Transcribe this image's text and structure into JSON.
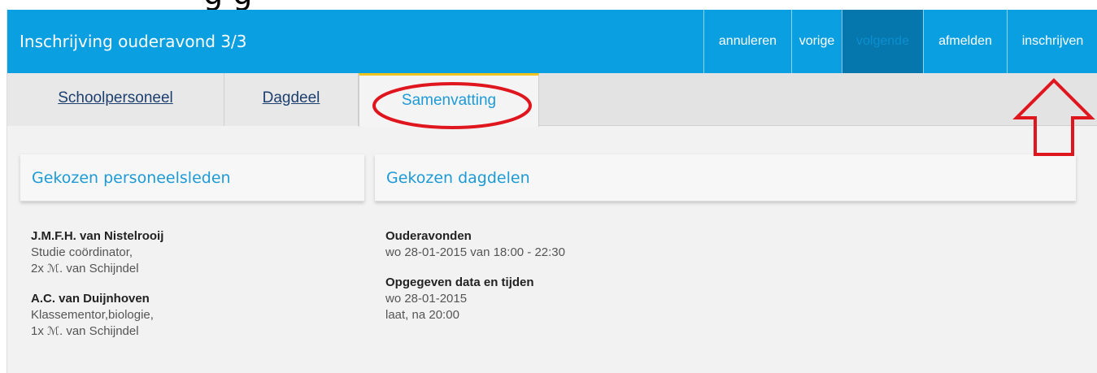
{
  "app": {
    "title": "Inschrijving ouderavond 3/3"
  },
  "actions": [
    {
      "label": "annuleren"
    },
    {
      "label": "vorige"
    },
    {
      "label": "volgende",
      "disabled": true
    },
    {
      "label": "afmelden"
    },
    {
      "label": "inschrijven"
    }
  ],
  "tabs": [
    {
      "label": "Schoolpersoneel"
    },
    {
      "label": "Dagdeel"
    },
    {
      "label": "Samenvatting",
      "active": true
    }
  ],
  "staff_panel": {
    "title": "Gekozen personeelsleden",
    "members": [
      {
        "name": "J.M.F.H. van Nistelrooij",
        "role": "Studie coördinator,",
        "count": "2x",
        "logo_letter": "ℳ",
        "location": ". van Schijndel"
      },
      {
        "name": "A.C. van Duijnhoven",
        "role": "Klassementor,biologie,",
        "count": "1x",
        "logo_letter": "ℳ",
        "location": ". van Schijndel"
      }
    ]
  },
  "dayparts_panel": {
    "title": "Gekozen dagdelen",
    "groups": [
      {
        "heading": "Ouderavonden",
        "lines": [
          "wo 28-01-2015 van 18:00 - 22:30"
        ]
      },
      {
        "heading": "Opgegeven data en tijden",
        "lines": [
          "wo 28-01-2015",
          "laat, na 20:00"
        ]
      }
    ]
  },
  "annotations": {
    "ellipse_color": "#e0161e",
    "arrow_color": "#e0161e"
  }
}
